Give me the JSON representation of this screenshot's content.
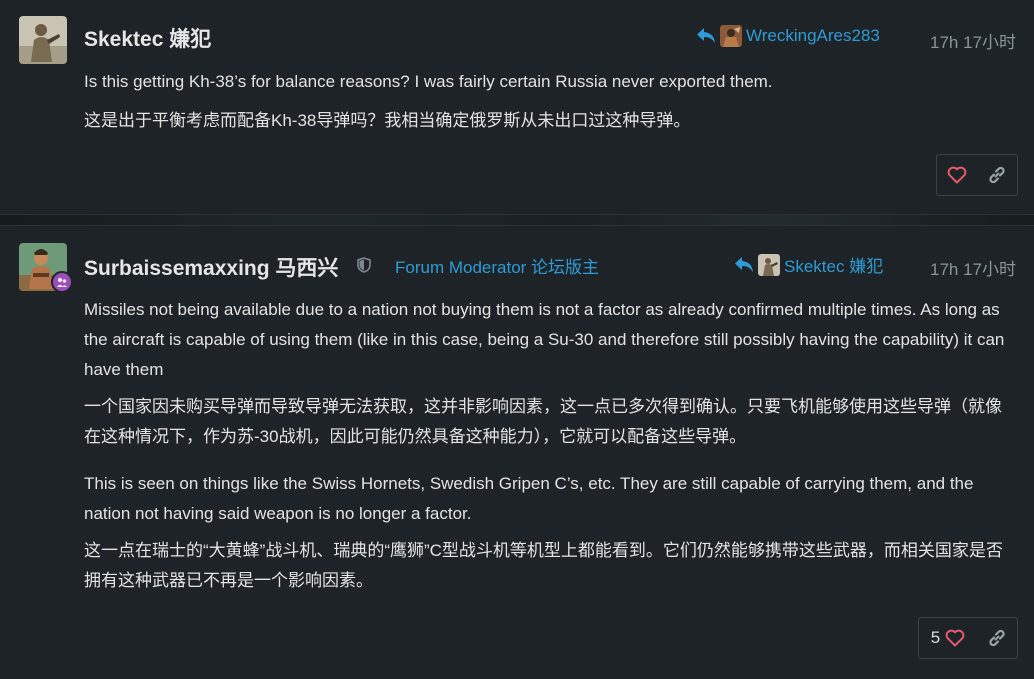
{
  "post1": {
    "username": "Skektec 嫌犯",
    "reply_to": "WreckingAres283",
    "time": "17h 17小时",
    "paragraphs": [
      "Is this getting Kh-38’s for balance reasons? I was fairly certain Russia never exported them.",
      "这是出于平衡考虑而配备Kh-38导弹吗？我相当确定俄罗斯从未出口过这种导弹。"
    ]
  },
  "post2": {
    "username": "Surbaissemaxxing 马西兴",
    "moderator_title": "Forum Moderator 论坛版主",
    "reply_to": "Skektec 嫌犯",
    "time": "17h 17小时",
    "paragraphs": [
      "Missiles not being available due to a nation not buying them is not a factor as already confirmed multiple times. As long as the aircraft is capable of using them (like in this case, being a Su-30 and therefore still possibly having the capability) it can have them",
      "一个国家因未购买导弹而导致导弹无法获取，这并非影响因素，这一点已多次得到确认。只要飞机能够使用这些导弹（就像在这种情况下，作为苏-30战机，因此可能仍然具备这种能力），它就可以配备这些导弹。",
      "This is seen on things like the Swiss Hornets, Swedish Gripen C’s, etc. They are still capable of carrying them, and the nation not having said weapon is no longer a factor.",
      "这一点在瑞士的“大黄蜂”战斗机、瑞典的“鹰狮”C型战斗机等机型上都能看到。它们仍然能够携带这些武器，而相关国家是否拥有这种武器已不再是一个影响因素。"
    ],
    "like_count": "5"
  },
  "colors": {
    "accent": "#2f9bd6",
    "like": "#e45a6a",
    "background": "#1d2326"
  },
  "icons": {
    "reply": "reply-arrow-icon",
    "like": "heart-icon",
    "link": "link-icon",
    "moderator": "shield-icon"
  }
}
